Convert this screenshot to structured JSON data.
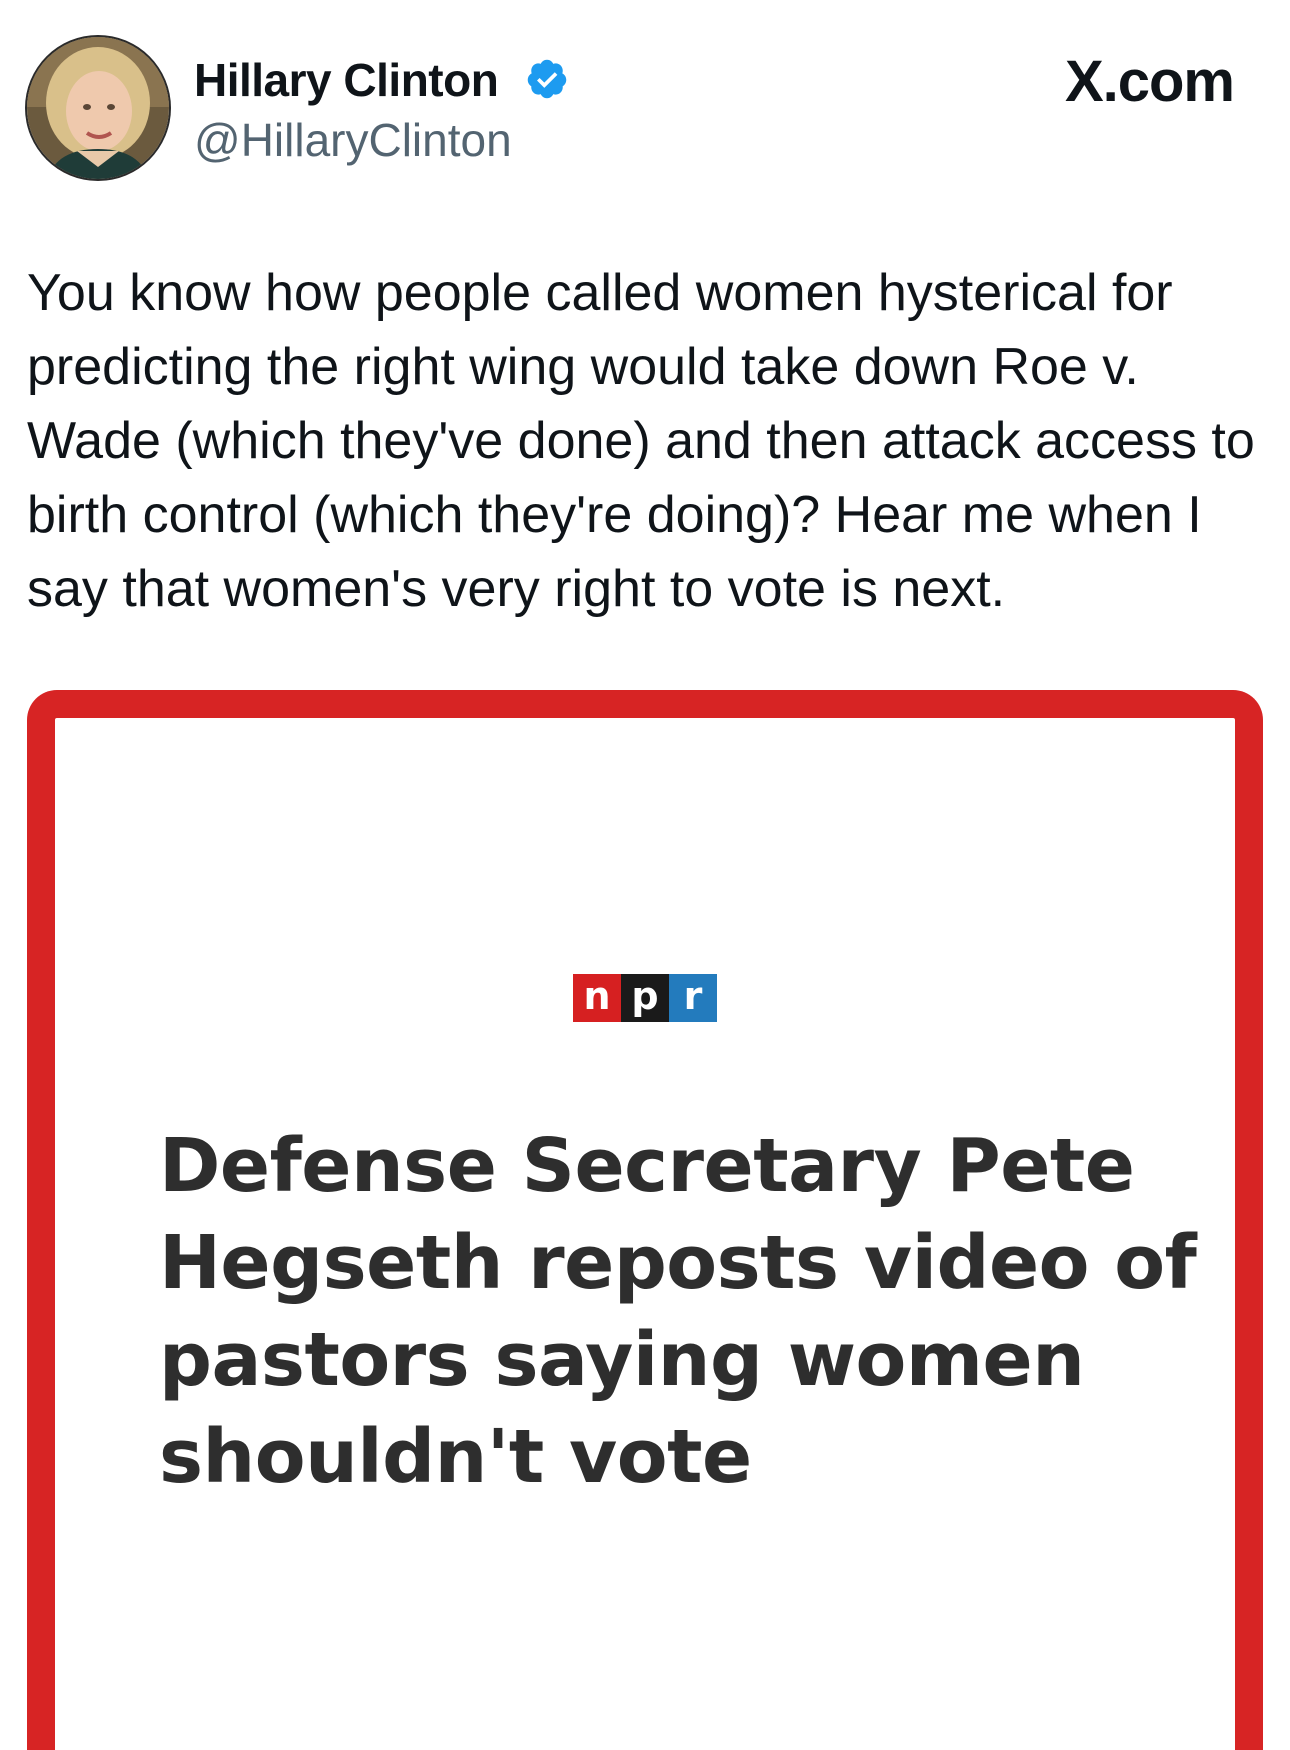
{
  "author": {
    "display_name": "Hillary Clinton",
    "handle": "@HillaryClinton",
    "verified": true,
    "verified_color": "#1d9bf0"
  },
  "brand": {
    "label": "X.com"
  },
  "tweet": {
    "text": "You know how people called women hysterical for predicting the right wing would take down Roe v. Wade (which they've done) and then attack access to birth control (which they're doing)? Hear me when I say that women's very right to vote is next."
  },
  "media": {
    "frame_color": "#d72424",
    "logo_letters": [
      "n",
      "p",
      "r"
    ],
    "logo_colors": [
      "#d62021",
      "#1a1a1a",
      "#237bbd"
    ],
    "headline": "Defense Secretary Pete Hegseth reposts video of pastors saying women shouldn't vote"
  }
}
